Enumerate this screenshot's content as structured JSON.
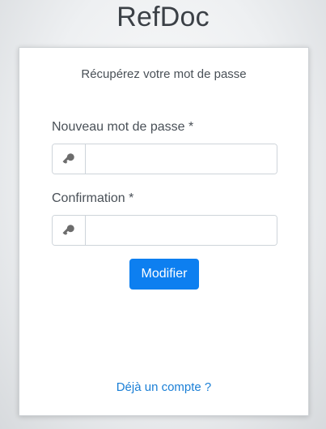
{
  "app": {
    "title": "RefDoc"
  },
  "card": {
    "heading": "Récupérez votre mot de passe",
    "fields": [
      {
        "label": "Nouveau mot de passe *",
        "icon": "key-icon",
        "value": "",
        "placeholder": ""
      },
      {
        "label": "Confirmation *",
        "icon": "key-icon",
        "value": "",
        "placeholder": ""
      }
    ],
    "submit_label": "Modifier",
    "login_link": "Déjà un compte ?"
  },
  "colors": {
    "primary": "#0d7ff0",
    "link": "#1a7fd6",
    "text": "#495057",
    "icon": "#6c6c6c"
  }
}
